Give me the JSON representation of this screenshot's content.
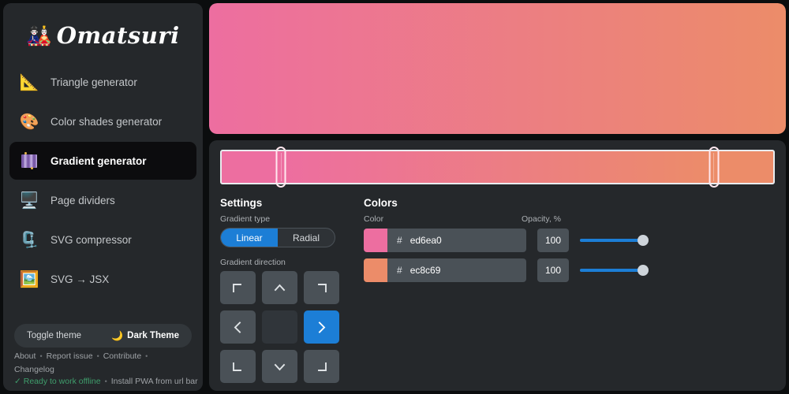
{
  "app": {
    "logo_emoji": "🎎",
    "logo_text": "Omatsuri",
    "background": "#0b0d0e",
    "panel_bg": "#25282b",
    "accent": "#1c7ed6"
  },
  "sidebar": {
    "items": [
      {
        "label": "Triangle generator",
        "icon": "triangular-ruler-icon",
        "glyph": "📐",
        "active": false
      },
      {
        "label": "Color shades generator",
        "icon": "color-palette-icon",
        "glyph": "🎨",
        "active": false
      },
      {
        "label": "Gradient generator",
        "icon": "gradient-bars-icon",
        "glyph": "",
        "active": true
      },
      {
        "label": "Page dividers",
        "icon": "desktop-monitor-icon",
        "glyph": "🖥️",
        "active": false
      },
      {
        "label": "SVG compressor",
        "icon": "compress-icon",
        "glyph": "🗜️",
        "active": false
      },
      {
        "label": "SVG → JSX",
        "icon": "framed-picture-icon",
        "glyph": "🖼️",
        "active": false
      }
    ],
    "theme_toggle": {
      "label": "Toggle theme",
      "value": "Dark Theme",
      "icon": "crescent-moon-icon",
      "glyph": "🌙"
    },
    "footer_links": [
      "About",
      "Report issue",
      "Contribute",
      "Changelog"
    ],
    "footer_separator": "•",
    "status": {
      "offline_check": "✓",
      "offline_text": "Ready to work offline",
      "offline_color": "#3f9e6c",
      "separator": "•",
      "pwa_text": "Install PWA from url bar"
    }
  },
  "preview": {
    "name": "gradient-preview",
    "css": "linear-gradient(90deg, #ed6ea0 0%, #ec8c69 100%)"
  },
  "strip": {
    "name": "gradient-stops-strip",
    "css": "linear-gradient(90deg, #ed6ea0 0%, #ed6ea0 11%, #ec8c69 89%, #ec8c69 100%)",
    "handles": [
      {
        "name": "gradient-stop-handle-1",
        "position_pct": 11
      },
      {
        "name": "gradient-stop-handle-2",
        "position_pct": 89
      }
    ]
  },
  "settings": {
    "title": "Settings",
    "gradient_type_label": "Gradient type",
    "gradient_type_options": [
      "Linear",
      "Radial"
    ],
    "gradient_type_selected": "Linear",
    "gradient_direction_label": "Gradient direction",
    "directions": [
      {
        "name": "direction-top-left",
        "icon": "corner-top-left-icon",
        "selected": false,
        "center": false
      },
      {
        "name": "direction-top",
        "icon": "chevron-up-icon",
        "selected": false,
        "center": false
      },
      {
        "name": "direction-top-right",
        "icon": "corner-top-right-icon",
        "selected": false,
        "center": false
      },
      {
        "name": "direction-left",
        "icon": "chevron-left-icon",
        "selected": false,
        "center": false
      },
      {
        "name": "direction-center",
        "icon": "none",
        "selected": false,
        "center": true
      },
      {
        "name": "direction-right",
        "icon": "chevron-right-icon",
        "selected": true,
        "center": false
      },
      {
        "name": "direction-bottom-left",
        "icon": "corner-bottom-left-icon",
        "selected": false,
        "center": false
      },
      {
        "name": "direction-bottom",
        "icon": "chevron-down-icon",
        "selected": false,
        "center": false
      },
      {
        "name": "direction-bottom-right",
        "icon": "corner-bottom-right-icon",
        "selected": false,
        "center": false
      }
    ]
  },
  "colors": {
    "title": "Colors",
    "col_color_label": "Color",
    "col_opacity_label": "Opacity, %",
    "hash_symbol": "#",
    "rows": [
      {
        "swatch": "#ed6ea0",
        "hex": "ed6ea0",
        "opacity": "100",
        "opacity_pct": 100
      },
      {
        "swatch": "#ec8c69",
        "hex": "ec8c69",
        "opacity": "100",
        "opacity_pct": 100
      }
    ]
  }
}
